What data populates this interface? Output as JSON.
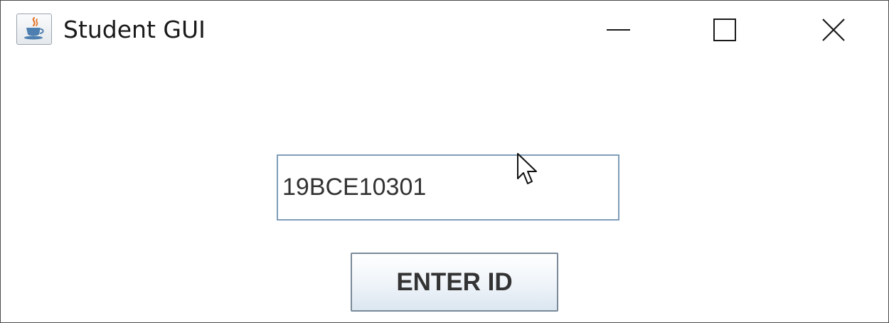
{
  "window": {
    "title": "Student GUI",
    "icon": "java-coffee-cup-icon",
    "controls": {
      "minimize": "minimize-icon",
      "maximize": "maximize-icon",
      "close": "close-icon"
    }
  },
  "form": {
    "id_field_value": "19BCE10301",
    "enter_button_label": "ENTER ID"
  },
  "colors": {
    "field_border": "#7f9db9",
    "button_border": "#7a8a99",
    "button_gradient_bottom": "#dbe6f1",
    "text": "#333333"
  }
}
